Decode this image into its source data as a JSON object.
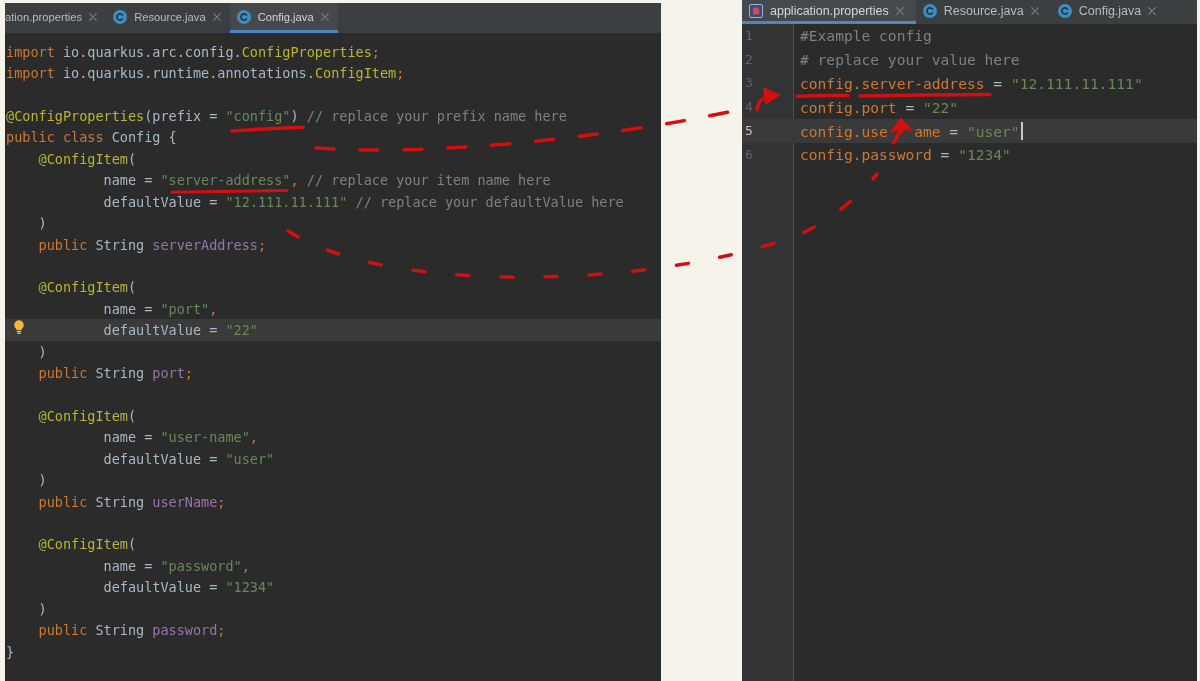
{
  "left_editor": {
    "tabs": [
      {
        "label": "ation.properties",
        "kind": "partial",
        "selected": false
      },
      {
        "label": "Resource.java",
        "kind": "java",
        "selected": false
      },
      {
        "label": "Config.java",
        "kind": "java",
        "selected": true
      }
    ],
    "lines": [
      {
        "current": false,
        "bulb": false,
        "tokens": [
          {
            "kind": "keyword",
            "text": "import"
          },
          {
            "kind": "plain",
            "text": " io.quarkus.arc.config."
          },
          {
            "kind": "annotation",
            "text": "ConfigProperties"
          },
          {
            "kind": "keyword",
            "text": ";"
          }
        ]
      },
      {
        "current": false,
        "bulb": false,
        "tokens": [
          {
            "kind": "keyword",
            "text": "import"
          },
          {
            "kind": "plain",
            "text": " io.quarkus.runtime.annotations."
          },
          {
            "kind": "annotation",
            "text": "ConfigItem"
          },
          {
            "kind": "keyword",
            "text": ";"
          }
        ]
      },
      {
        "current": false,
        "bulb": false
      },
      {
        "current": false,
        "bulb": false,
        "tokens": [
          {
            "kind": "annotation",
            "text": "@ConfigProperties"
          },
          {
            "kind": "plain",
            "text": "(prefix = "
          },
          {
            "kind": "string",
            "text": "\"config\""
          },
          {
            "kind": "plain",
            "text": ") "
          },
          {
            "kind": "comment",
            "text": "// replace your prefix name here"
          }
        ]
      },
      {
        "current": false,
        "bulb": false,
        "tokens": [
          {
            "kind": "keyword",
            "text": "public class "
          },
          {
            "kind": "plain",
            "text": "Config {"
          }
        ],
        "children": [
          {
            "current": false,
            "bulb": false,
            "tokens": [
              {
                "kind": "annotation",
                "text": "@ConfigItem"
              },
              {
                "kind": "plain",
                "text": "("
              }
            ],
            "children": [
              {
                "current": false,
                "bulb": false,
                "tokens": [
                  {
                    "kind": "plain",
                    "text": "name = "
                  },
                  {
                    "kind": "string",
                    "text": "\"server-address\""
                  },
                  {
                    "kind": "keyword",
                    "text": ","
                  },
                  {
                    "kind": "comment",
                    "text": " // replace your item name here"
                  }
                ]
              },
              {
                "current": false,
                "bulb": false,
                "tokens": [
                  {
                    "kind": "plain",
                    "text": "defaultValue = "
                  },
                  {
                    "kind": "string",
                    "text": "\"12.111.11.111\""
                  },
                  {
                    "kind": "comment",
                    "text": " // replace your defaultValue here"
                  }
                ]
              }
            ]
          },
          {
            "current": false,
            "bulb": false,
            "tokens": [
              {
                "kind": "plain",
                "text": ")"
              }
            ]
          },
          {
            "current": false,
            "bulb": false,
            "tokens": [
              {
                "kind": "keyword",
                "text": "public "
              },
              {
                "kind": "plain",
                "text": "String "
              },
              {
                "kind": "field",
                "text": "serverAddress"
              },
              {
                "kind": "keyword",
                "text": ";"
              }
            ]
          },
          {
            "current": false,
            "bulb": false
          },
          {
            "current": false,
            "bulb": false,
            "tokens": [
              {
                "kind": "annotation",
                "text": "@ConfigItem"
              },
              {
                "kind": "plain",
                "text": "("
              }
            ],
            "children": [
              {
                "current": false,
                "bulb": false,
                "tokens": [
                  {
                    "kind": "plain",
                    "text": "name = "
                  },
                  {
                    "kind": "string",
                    "text": "\"port\""
                  },
                  {
                    "kind": "keyword",
                    "text": ","
                  }
                ]
              },
              {
                "current": true,
                "bulb": true,
                "tokens": [
                  {
                    "kind": "plain",
                    "text": "defaultValue = "
                  },
                  {
                    "kind": "string",
                    "text": "\"22\""
                  }
                ]
              }
            ]
          },
          {
            "current": false,
            "bulb": false,
            "tokens": [
              {
                "kind": "plain",
                "text": ")"
              }
            ]
          },
          {
            "current": false,
            "bulb": false,
            "tokens": [
              {
                "kind": "keyword",
                "text": "public "
              },
              {
                "kind": "plain",
                "text": "String "
              },
              {
                "kind": "field",
                "text": "port"
              },
              {
                "kind": "keyword",
                "text": ";"
              }
            ]
          },
          {
            "current": false,
            "bulb": false
          },
          {
            "current": false,
            "bulb": false,
            "tokens": [
              {
                "kind": "annotation",
                "text": "@ConfigItem"
              },
              {
                "kind": "plain",
                "text": "("
              }
            ],
            "children": [
              {
                "current": false,
                "bulb": false,
                "tokens": [
                  {
                    "kind": "plain",
                    "text": "name = "
                  },
                  {
                    "kind": "string",
                    "text": "\"user-name\""
                  },
                  {
                    "kind": "keyword",
                    "text": ","
                  }
                ]
              },
              {
                "current": false,
                "bulb": false,
                "tokens": [
                  {
                    "kind": "plain",
                    "text": "defaultValue = "
                  },
                  {
                    "kind": "string",
                    "text": "\"user\""
                  }
                ]
              }
            ]
          },
          {
            "current": false,
            "bulb": false,
            "tokens": [
              {
                "kind": "plain",
                "text": ")"
              }
            ]
          },
          {
            "current": false,
            "bulb": false,
            "tokens": [
              {
                "kind": "keyword",
                "text": "public "
              },
              {
                "kind": "plain",
                "text": "String "
              },
              {
                "kind": "field",
                "text": "userName"
              },
              {
                "kind": "keyword",
                "text": ";"
              }
            ]
          },
          {
            "current": false,
            "bulb": false
          },
          {
            "current": false,
            "bulb": false,
            "tokens": [
              {
                "kind": "annotation",
                "text": "@ConfigItem"
              },
              {
                "kind": "plain",
                "text": "("
              }
            ],
            "children": [
              {
                "current": false,
                "bulb": false,
                "tokens": [
                  {
                    "kind": "plain",
                    "text": "name = "
                  },
                  {
                    "kind": "string",
                    "text": "\"password\""
                  },
                  {
                    "kind": "keyword",
                    "text": ","
                  }
                ]
              },
              {
                "current": false,
                "bulb": false,
                "tokens": [
                  {
                    "kind": "plain",
                    "text": "defaultValue = "
                  },
                  {
                    "kind": "string",
                    "text": "\"1234\""
                  }
                ]
              }
            ]
          },
          {
            "current": false,
            "bulb": false,
            "tokens": [
              {
                "kind": "plain",
                "text": ")"
              }
            ]
          },
          {
            "current": false,
            "bulb": false,
            "tokens": [
              {
                "kind": "keyword",
                "text": "public "
              },
              {
                "kind": "plain",
                "text": "String "
              },
              {
                "kind": "field",
                "text": "password"
              },
              {
                "kind": "keyword",
                "text": ";"
              }
            ]
          }
        ]
      },
      {
        "current": false,
        "bulb": false,
        "tokens": [
          {
            "kind": "plain",
            "text": "}"
          }
        ]
      }
    ]
  },
  "right_editor": {
    "tabs": [
      {
        "label": "application.properties",
        "kind": "properties",
        "selected": true
      },
      {
        "label": "Resource.java",
        "kind": "java",
        "selected": false
      },
      {
        "label": "Config.java",
        "kind": "java",
        "selected": false
      }
    ],
    "lines": [
      {
        "number": "1",
        "current": false,
        "caret": false,
        "tokens": [
          {
            "kind": "comment",
            "text": "#Example config"
          }
        ]
      },
      {
        "number": "2",
        "current": false,
        "caret": false,
        "tokens": [
          {
            "kind": "comment",
            "text": "# replace your value here"
          }
        ]
      },
      {
        "number": "3",
        "current": false,
        "caret": false,
        "tokens": [
          {
            "kind": "key",
            "text": "config.server-address"
          },
          {
            "kind": "plain",
            "text": " = "
          },
          {
            "kind": "value",
            "text": "\"12.111.11.111\""
          }
        ]
      },
      {
        "number": "4",
        "current": false,
        "caret": false,
        "tokens": [
          {
            "kind": "key",
            "text": "config.port"
          },
          {
            "kind": "plain",
            "text": " = "
          },
          {
            "kind": "value",
            "text": "\"22\""
          }
        ]
      },
      {
        "number": "5",
        "current": true,
        "caret": true,
        "tokens": [
          {
            "kind": "key",
            "text": "config.use"
          },
          {
            "kind": "covered"
          },
          {
            "kind": "key",
            "text": "ame"
          },
          {
            "kind": "plain",
            "text": " = "
          },
          {
            "kind": "value",
            "text": "\"user\""
          }
        ]
      },
      {
        "number": "6",
        "current": false,
        "caret": false,
        "tokens": [
          {
            "kind": "key",
            "text": "config.password"
          },
          {
            "kind": "plain",
            "text": " = "
          },
          {
            "kind": "value",
            "text": "\"1234\""
          }
        ]
      }
    ]
  }
}
